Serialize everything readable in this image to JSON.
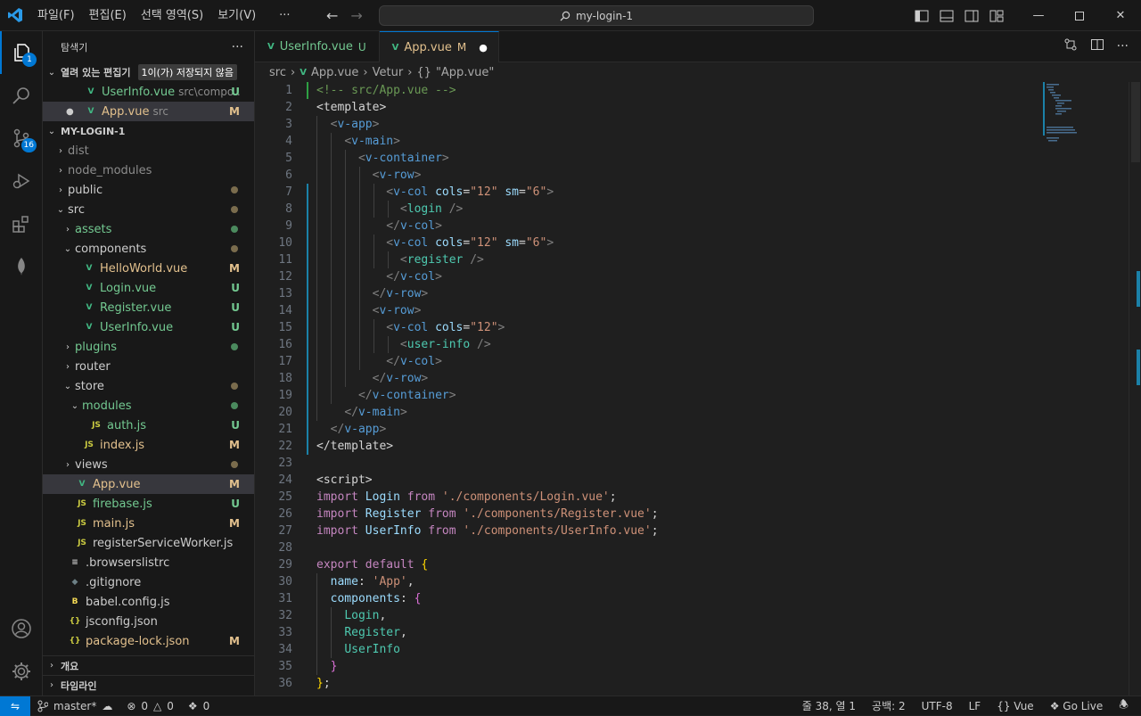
{
  "titlebar": {
    "menu": [
      "파일(F)",
      "편집(E)",
      "선택 영역(S)",
      "보기(V)",
      "···"
    ],
    "search": "my-login-1"
  },
  "activity": {
    "explorer_badge": "1",
    "scm_badge": "16"
  },
  "explorer": {
    "title": "탐색기",
    "more": "···",
    "open_editors": {
      "label": "열려 있는 편집기",
      "unsaved": "1이(가) 저장되지 않음",
      "items": [
        {
          "name": "UserInfo.vue",
          "desc": "src\\compo...",
          "status": "U"
        },
        {
          "name": "App.vue",
          "desc": "src",
          "status": "M"
        }
      ]
    },
    "root": "MY-LOGIN-1",
    "tree": [
      {
        "name": "dist",
        "status": ""
      },
      {
        "name": "node_modules",
        "status": ""
      },
      {
        "name": "public",
        "status": ""
      },
      {
        "name": "src",
        "status": ""
      },
      {
        "name": "assets",
        "status": ""
      },
      {
        "name": "components",
        "status": ""
      },
      {
        "name": "HelloWorld.vue",
        "status": "M"
      },
      {
        "name": "Login.vue",
        "status": "U"
      },
      {
        "name": "Register.vue",
        "status": "U"
      },
      {
        "name": "UserInfo.vue",
        "status": "U"
      },
      {
        "name": "plugins",
        "status": ""
      },
      {
        "name": "router",
        "status": ""
      },
      {
        "name": "store",
        "status": ""
      },
      {
        "name": "modules",
        "status": ""
      },
      {
        "name": "auth.js",
        "status": "U"
      },
      {
        "name": "index.js",
        "status": "M"
      },
      {
        "name": "views",
        "status": ""
      },
      {
        "name": "App.vue",
        "status": "M"
      },
      {
        "name": "firebase.js",
        "status": "U"
      },
      {
        "name": "main.js",
        "status": "M"
      },
      {
        "name": "registerServiceWorker.js",
        "status": ""
      },
      {
        "name": ".browserslistrc",
        "status": ""
      },
      {
        "name": ".gitignore",
        "status": ""
      },
      {
        "name": "babel.config.js",
        "status": ""
      },
      {
        "name": "jsconfig.json",
        "status": ""
      },
      {
        "name": "package-lock.json",
        "status": "M"
      }
    ],
    "outline": "개요",
    "timeline": "타임라인"
  },
  "tabs": [
    {
      "name": "UserInfo.vue",
      "status": "U"
    },
    {
      "name": "App.vue",
      "status": "M"
    }
  ],
  "breadcrumb": {
    "p1": "src",
    "p2": "App.vue",
    "p3": "Vetur",
    "p4": "\"App.vue\"",
    "sym": "{}"
  },
  "statusbar": {
    "branch": "master*",
    "errors": "0",
    "warnings": "0",
    "ports": "0",
    "position": "줄 38, 열 1",
    "spaces": "공백: 2",
    "encoding": "UTF-8",
    "eol": "LF",
    "language": "Vue",
    "golive": "Go Live"
  }
}
